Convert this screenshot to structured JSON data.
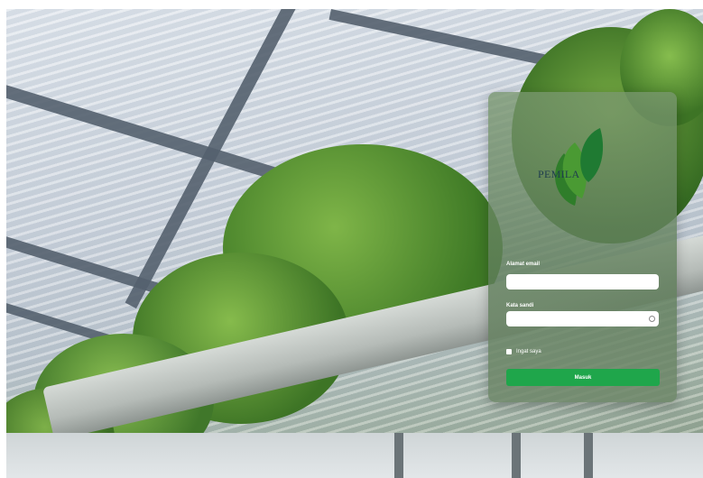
{
  "brand": {
    "name": "PEMILA",
    "icon": "leaf-logo-icon"
  },
  "login": {
    "email_label": "Alamat email",
    "email_value": "",
    "password_label": "Kata sandi",
    "password_value": "",
    "password_toggle_icon": "eye-icon",
    "remember_label": "Ingat saya",
    "submit_label": "Masuk"
  },
  "colors": {
    "button": "#1fa64b",
    "card": "#6f8d66"
  }
}
